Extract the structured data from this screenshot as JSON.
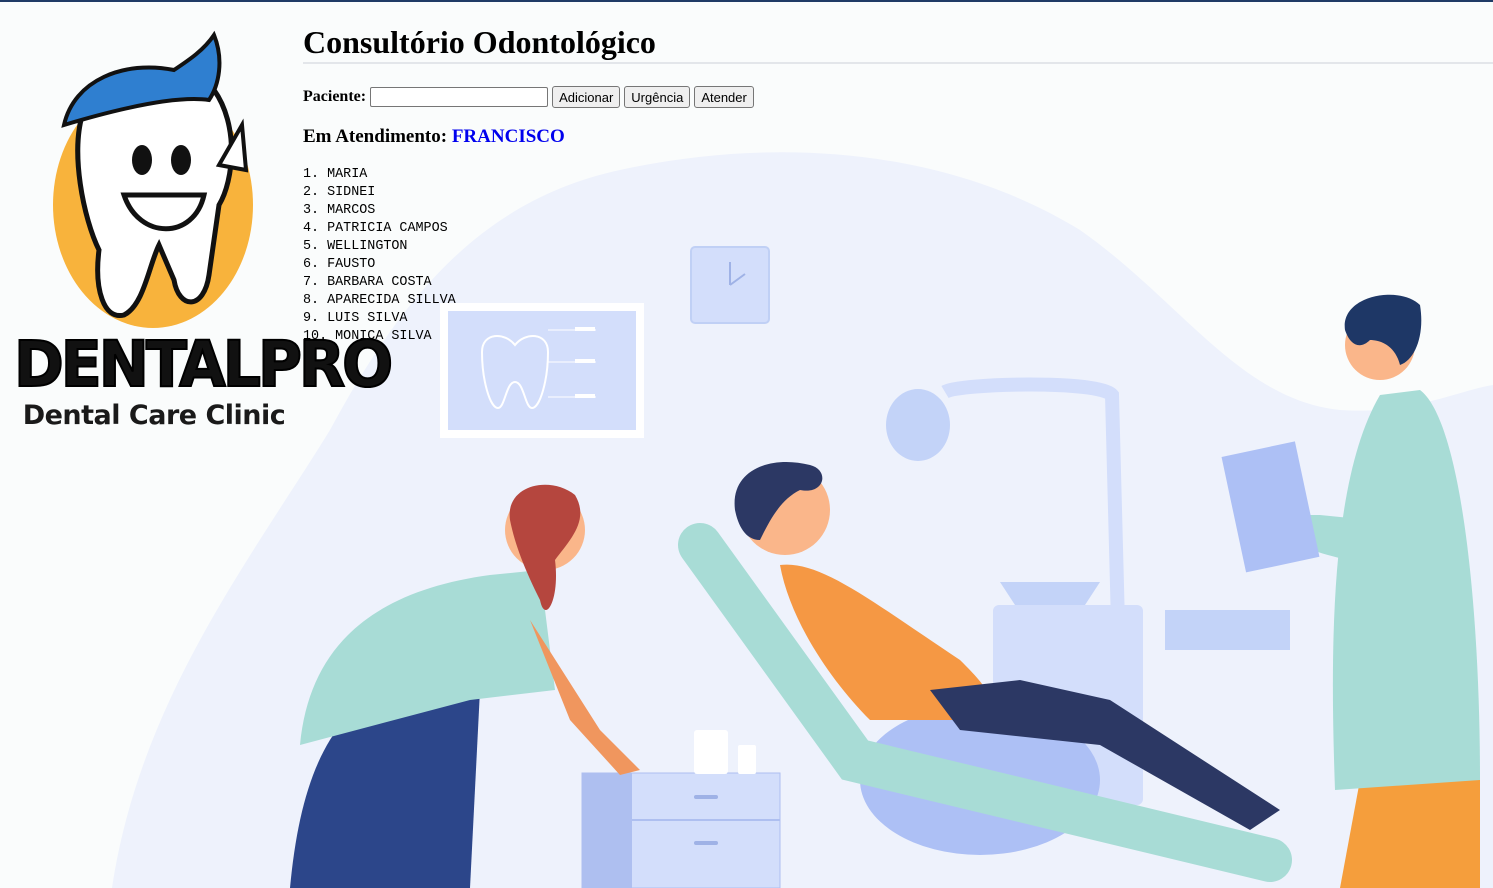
{
  "page": {
    "title": "Consultório Odontológico"
  },
  "logo": {
    "brand": "DENTALPRO",
    "tagline": "Dental Care Clinic"
  },
  "form": {
    "patient_label": "Paciente:",
    "patient_value": "",
    "patient_placeholder": "",
    "add_label": "Adicionar",
    "urgent_label": "Urgência",
    "attend_label": "Atender"
  },
  "attending": {
    "label": "Em Atendimento:",
    "name": "FRANCISCO"
  },
  "queue": [
    "1. MARIA",
    "2. SIDNEI",
    "3. MARCOS",
    "4. PATRICIA CAMPOS",
    "5. WELLINGTON",
    "6. FAUSTO",
    "7. BARBARA COSTA",
    "8. APARECIDA SILLVA",
    "9. LUIS SILVA",
    "10. MONICA SILVA"
  ]
}
